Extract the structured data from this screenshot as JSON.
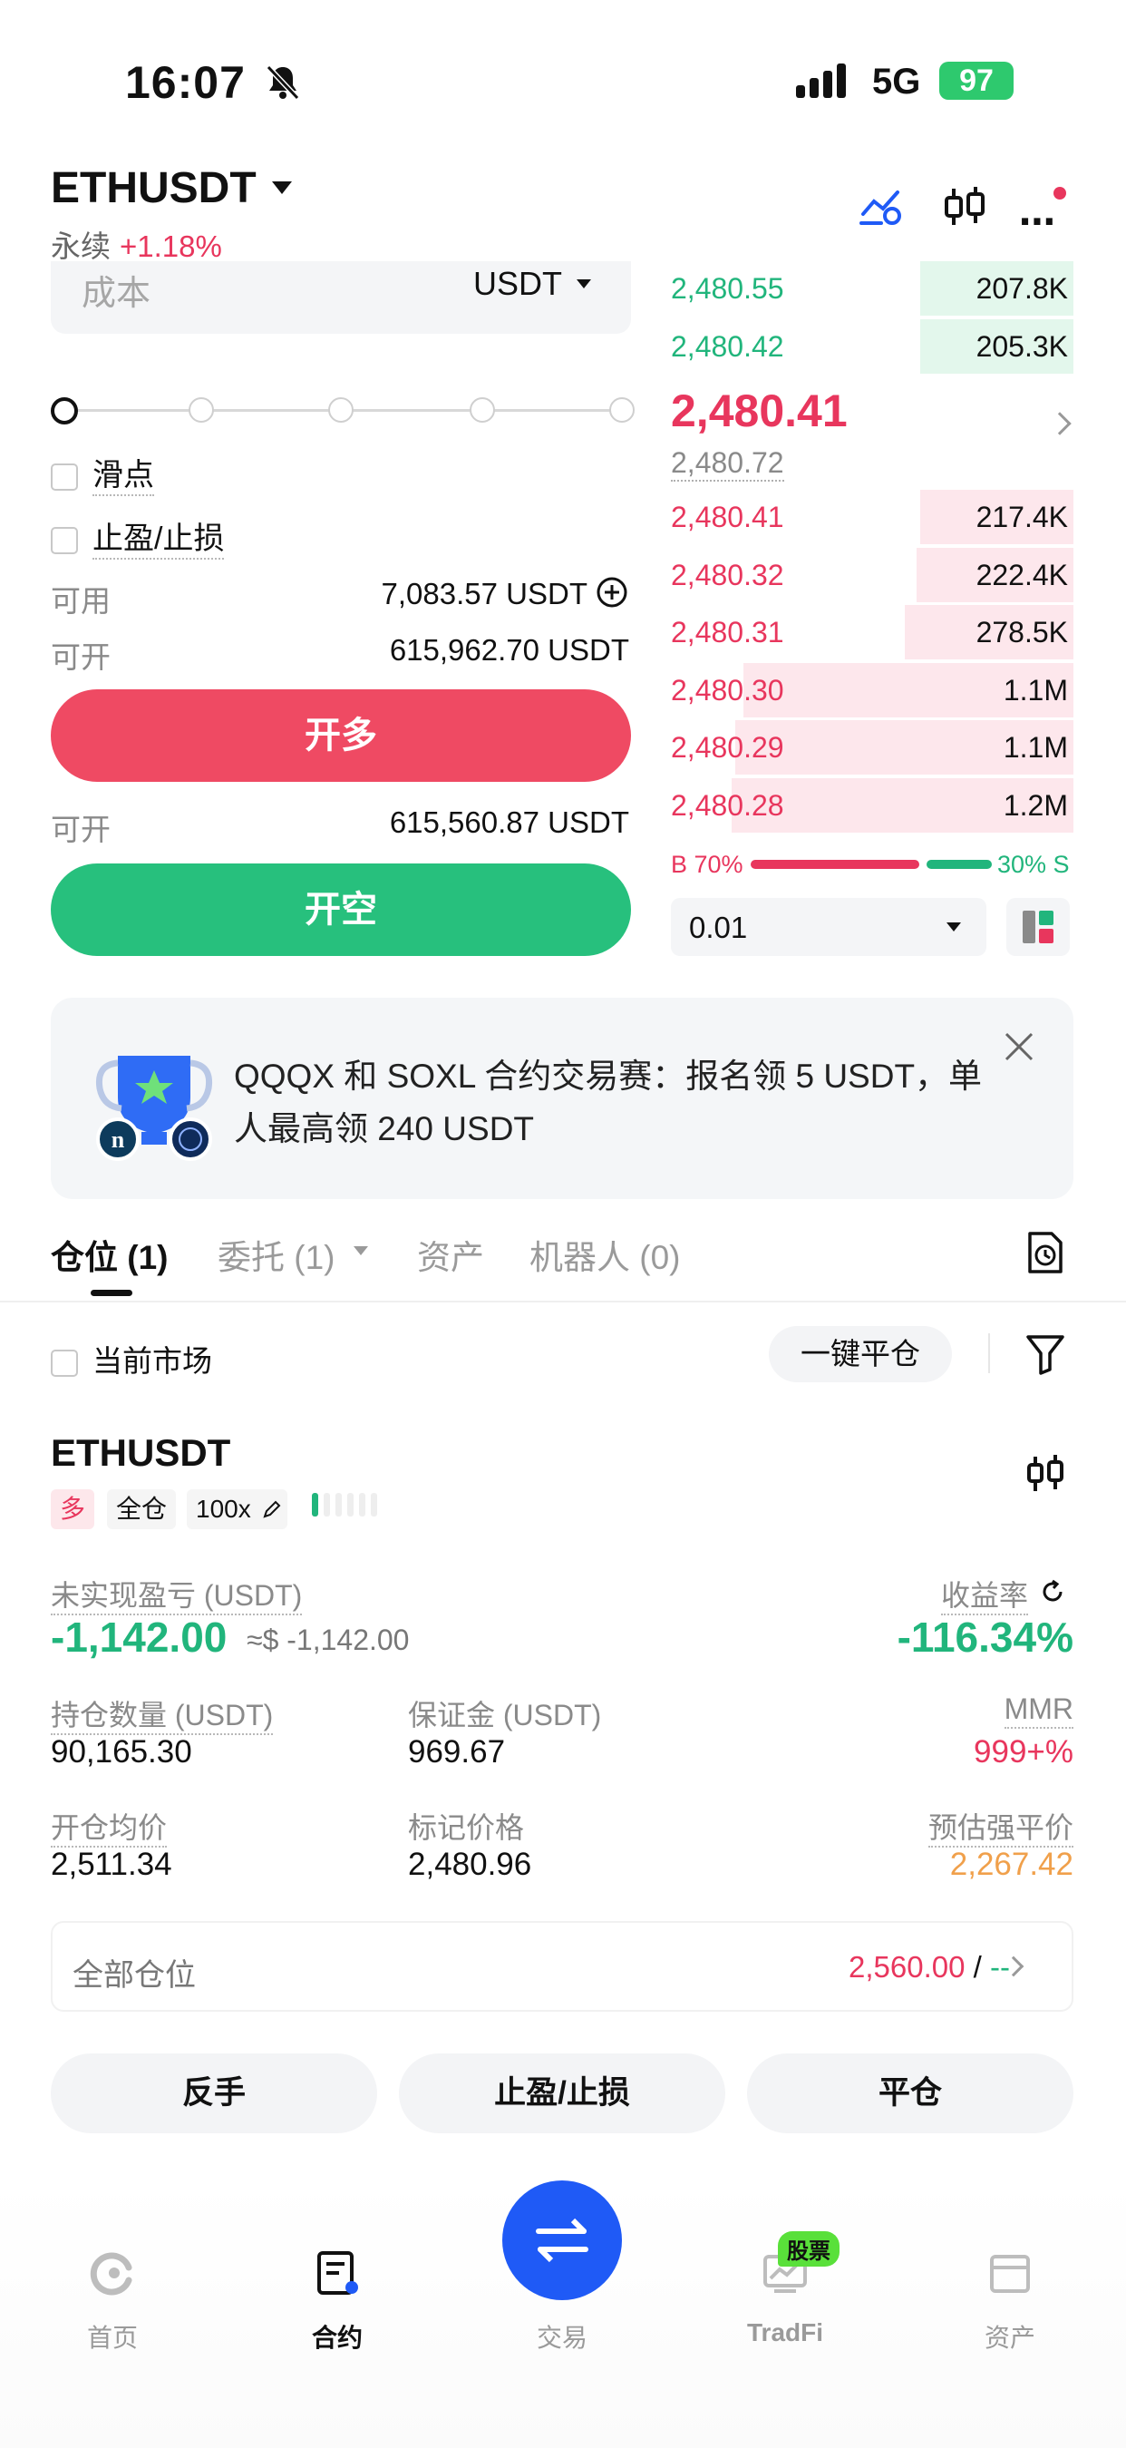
{
  "status_bar": {
    "time": "16:07",
    "network": "5G",
    "battery": "97"
  },
  "header": {
    "symbol": "ETHUSDT",
    "contract_type": "永续",
    "change": "+1.18%"
  },
  "order_form": {
    "cost_placeholder": "成本",
    "cost_unit": "USDT",
    "slippage_label": "滑点",
    "tpsl_label": "止盈/止损",
    "available_label": "可用",
    "available_value": "7,083.57 USDT",
    "open_label_1": "可开",
    "open_value_1": "615,962.70 USDT",
    "open_long_label": "开多",
    "open_label_2": "可开",
    "open_value_2": "615,560.87 USDT",
    "open_short_label": "开空"
  },
  "order_book": {
    "asks": [
      {
        "price": "2,480.55",
        "qty": "207.8K",
        "depth": 0.38
      },
      {
        "price": "2,480.42",
        "qty": "205.3K",
        "depth": 0.38
      }
    ],
    "last_price": "2,480.41",
    "mark_price": "2,480.72",
    "bids": [
      {
        "price": "2,480.41",
        "qty": "217.4K",
        "depth": 0.38
      },
      {
        "price": "2,480.32",
        "qty": "222.4K",
        "depth": 0.39
      },
      {
        "price": "2,480.31",
        "qty": "278.5K",
        "depth": 0.42
      },
      {
        "price": "2,480.30",
        "qty": "1.1M",
        "depth": 0.82
      },
      {
        "price": "2,480.29",
        "qty": "1.1M",
        "depth": 0.84
      },
      {
        "price": "2,480.28",
        "qty": "1.2M",
        "depth": 0.85
      }
    ],
    "buy_ratio": "B 70%",
    "sell_ratio": "30% S",
    "precision": "0.01"
  },
  "banner": {
    "text": "QQQX 和 SOXL 合约交易赛：报名领 5 USDT，单人最高领 240 USDT"
  },
  "tabs": [
    "仓位 (1)",
    "委托 (1)",
    "资产",
    "机器人 (0)"
  ],
  "filter": {
    "current_market_label": "当前市场",
    "close_all_label": "一键平仓"
  },
  "position": {
    "symbol": "ETHUSDT",
    "side": "多",
    "margin_mode": "全仓",
    "leverage": "100x",
    "upnl_label": "未实现盈亏 (USDT)",
    "upnl_value": "-1,142.00",
    "upnl_usd": "≈$ -1,142.00",
    "roe_label": "收益率",
    "roe_value": "-116.34%",
    "size_label": "持仓数量 (USDT)",
    "size_value": "90,165.30",
    "margin_label": "保证金 (USDT)",
    "margin_value": "969.67",
    "mmr_label": "MMR",
    "mmr_value": "999+%",
    "entry_label": "开仓均价",
    "entry_value": "2,511.34",
    "mark_label": "标记价格",
    "mark_value": "2,480.96",
    "liq_label": "预估强平价",
    "liq_value": "2,267.42",
    "all_positions_label": "全部仓位",
    "all_positions_value": "2,560.00",
    "all_positions_sep": "/",
    "all_positions_dash": "--"
  },
  "actions": {
    "reverse": "反手",
    "tpsl": "止盈/止损",
    "close": "平仓"
  },
  "bottom_nav": {
    "home": "首页",
    "futures": "合约",
    "trade": "交易",
    "tradfi": "TradFi",
    "tradfi_badge": "股票",
    "assets": "资产"
  },
  "colors": {
    "red": "#e8365d",
    "green": "#21b57c",
    "blue": "#1f5af6",
    "orange": "#f0a04b"
  }
}
